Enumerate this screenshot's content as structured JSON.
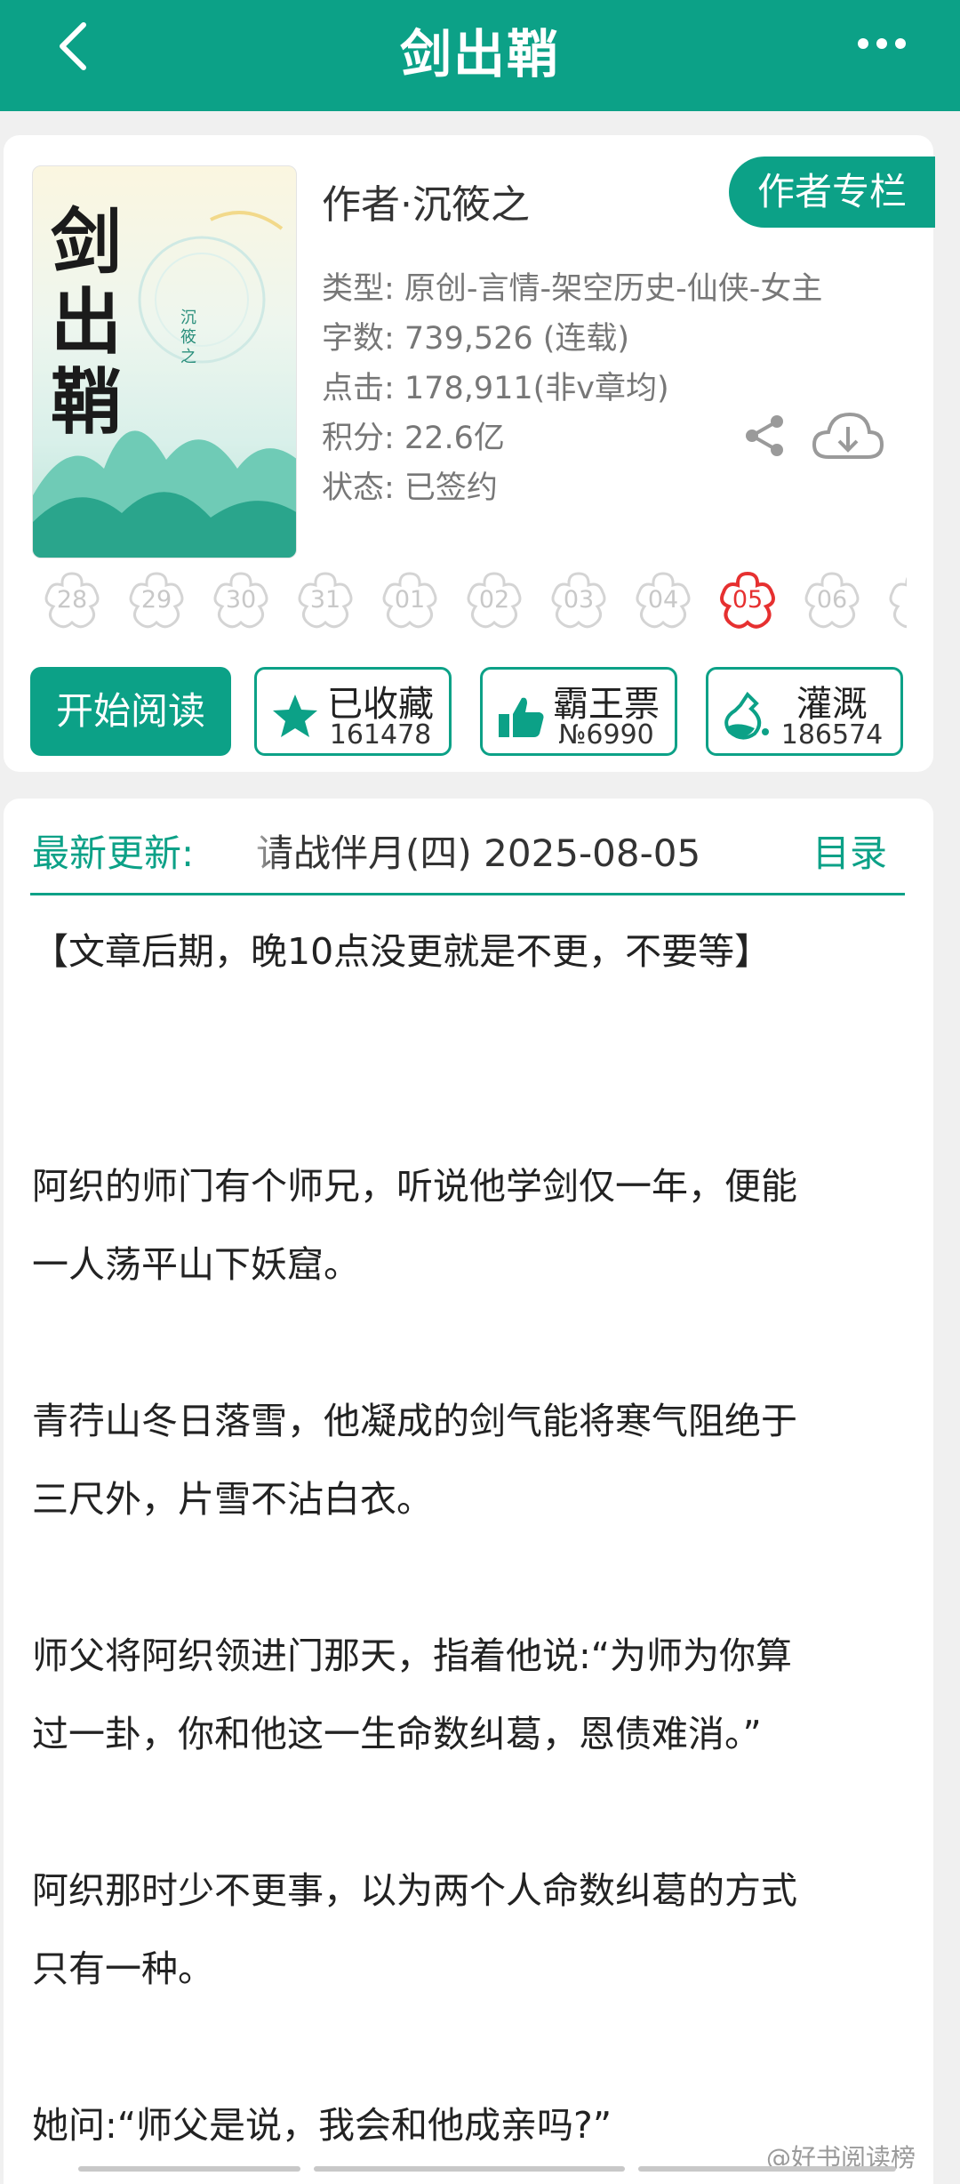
{
  "header": {
    "title": "剑出鞘",
    "back_icon": "back-arrow-icon",
    "more_icon": "more-dots-icon",
    "color": "#0ca187"
  },
  "book": {
    "cover_title": "剑出鞘",
    "cover_author": "沉筱之",
    "author_line": "作者·沉筱之",
    "author_column_button": "作者专栏",
    "info": {
      "type": "类型: 原创-言情-架空历史-仙侠-女主",
      "words": "字数: 739,526 (连载)",
      "clicks": "点击: 178,911(非v章均)",
      "score": "积分: 22.6亿",
      "status": "状态: 已签约"
    }
  },
  "dates": [
    "28",
    "29",
    "30",
    "31",
    "01",
    "02",
    "03",
    "04",
    "05",
    "06"
  ],
  "active_date": "05",
  "actions": {
    "read": "开始阅读",
    "collect": {
      "label": "已收藏",
      "value": "161478"
    },
    "vote": {
      "label": "霸王票",
      "value": "№6990"
    },
    "nutrient": {
      "label": "灌溉",
      "value": "186574"
    }
  },
  "latest": {
    "label": "最新更新:",
    "title": "请战伴月(四) 2025-08-05",
    "toc": "目录"
  },
  "synopsis": [
    "【文章后期，晚10点没更就是不更，不要等】",
    "阿织的师门有个师兄，听说他学剑仅一年，便能",
    "一人荡平山下妖窟。",
    "青荇山冬日落雪，他凝成的剑气能将寒气阻绝于",
    "三尺外，片雪不沾白衣。",
    "师父将阿织领进门那天，指着他说:“为师为你算",
    "过一卦，你和他这一生命数纠葛，恩债难消。”",
    "阿织那时少不更事，以为两个人命数纠葛的方式",
    "只有一种。",
    "她问:“师父是说，我会和他成亲吗?”"
  ],
  "watermark": "@好书阅读榜"
}
